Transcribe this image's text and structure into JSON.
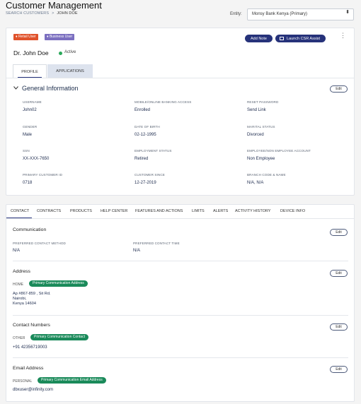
{
  "page_title": "Customer Management",
  "breadcrumb": {
    "parent": "SEARCH CUSTOMERS",
    "separator": ">",
    "current": "JOHN DOE"
  },
  "entity": {
    "label": "Entity:",
    "selected": "Monsy Bank Kenya (Primary)",
    "caret": "⬍"
  },
  "profile": {
    "badges": [
      "♦ Retail User",
      "♦ Business User"
    ],
    "add_note": "Add Note",
    "launch": "Launch CSR Assist",
    "kebab": "⋮",
    "name": "Dr. John Doe",
    "status": "Active",
    "tabs": [
      "PROFILE",
      "APPLICATIONS"
    ]
  },
  "general": {
    "title": "General Information",
    "edit": "Edit",
    "fields": [
      {
        "label": "USERNAME",
        "value": "John02"
      },
      {
        "label": "MOBILE/ONLINE BANKING ACCESS",
        "value": "Enrolled"
      },
      {
        "label": "RESET PASSWORD",
        "value": "Send Link"
      },
      {
        "label": "GENDER",
        "value": "Male"
      },
      {
        "label": "DATE OF BIRTH",
        "value": "02-12-1995"
      },
      {
        "label": "MARITAL STATUS",
        "value": "Divorced"
      },
      {
        "label": "SSN",
        "value": "XX-XXX-7650"
      },
      {
        "label": "EMPLOYMENT STATUS",
        "value": "Retired"
      },
      {
        "label": "EMPLOYEE/NON EMPLOYEE ACCOUNT",
        "value": "Non Employee"
      },
      {
        "label": "PRIMARY CUSTOMER ID",
        "value": "0718"
      },
      {
        "label": "CUSTOMER SINCE",
        "value": "12-27-2019"
      },
      {
        "label": "BRANCH CODE & NAME",
        "value": "N/A, N/A"
      }
    ]
  },
  "detail_tabs": [
    "CONTACT",
    "CONTRACTS",
    "PRODUCTS",
    "HELP CENTER",
    "FEATURES AND ACTIONS",
    "LIMITS",
    "ALERTS",
    "ACTIVITY HISTORY",
    "DEVICE INFO"
  ],
  "communication": {
    "title": "Communication",
    "edit": "Edit",
    "method_label": "PREFERRED CONTACT METHOD",
    "method_value": "N/A",
    "time_label": "PREFERRED CONTACT TIME",
    "time_value": "N/A"
  },
  "address": {
    "title": "Address",
    "edit": "Edit",
    "type": "HOME",
    "pill": "Primary Communication Address",
    "line1": "Ap #867-859 , Sit Rd.",
    "line2": "Nairobi,",
    "line3": "Kenya 14604"
  },
  "contact_numbers": {
    "title": "Contact Numbers",
    "edit": "Edit",
    "type": "OTHER",
    "pill": "Primary Communication Contact",
    "value": "+91 42356719003"
  },
  "email": {
    "title": "Email Address",
    "edit": "Edit",
    "type": "PERSONAL",
    "pill": "Primary Communication Email Address",
    "value": "dbxuser@infinity.com"
  },
  "colors": {
    "accent": "#26327a",
    "success": "#1a8a5a",
    "retail": "#e0522b",
    "business": "#7b6fc0"
  }
}
